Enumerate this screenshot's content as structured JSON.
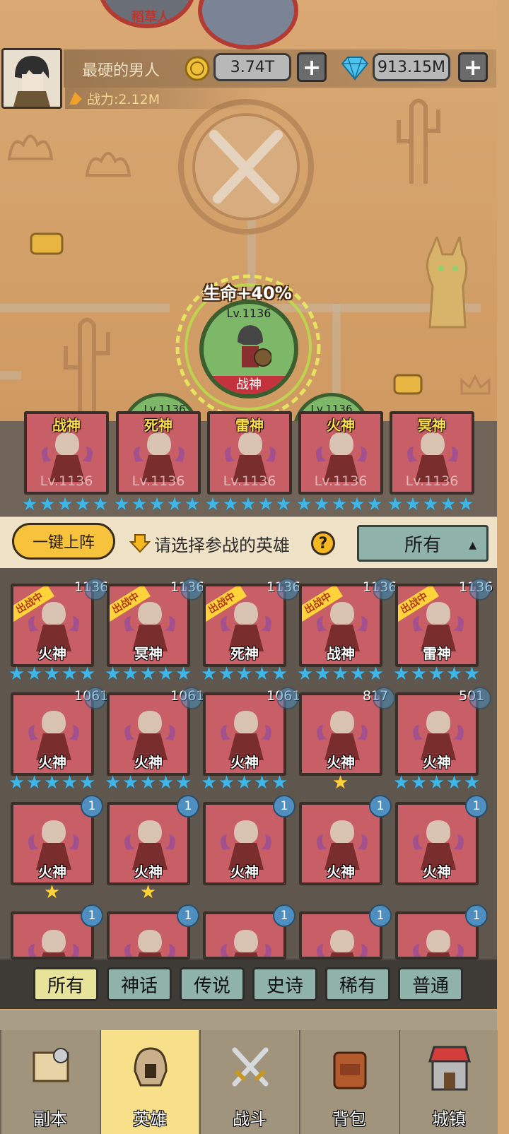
{
  "map": {
    "boss_left_label": "稻草人",
    "buff_text": "生命+40%",
    "center_hero_level": "Lv.1136",
    "center_hero_name": "战神",
    "side_levels": [
      "Lv.1136",
      "Lv.1136"
    ]
  },
  "header": {
    "player_name": "最硬的男人",
    "gold": "3.74T",
    "diamonds": "913.15M",
    "plus": "+",
    "power": "战力:2.12M"
  },
  "team": [
    {
      "name": "战神",
      "level": "Lv.1136",
      "stars": 5
    },
    {
      "name": "死神",
      "level": "Lv.1136",
      "stars": 5
    },
    {
      "name": "雷神",
      "level": "Lv.1136",
      "stars": 5
    },
    {
      "name": "火神",
      "level": "Lv.1136",
      "stars": 5
    },
    {
      "name": "冥神",
      "level": "Lv.1136",
      "stars": 5
    }
  ],
  "controls": {
    "auto_button": "一键上阵",
    "hint": "请选择参战的英雄",
    "help": "?",
    "filter": "所有"
  },
  "heroes": [
    {
      "name": "火神",
      "level": "1136",
      "deployed": "出战中",
      "stars": 5,
      "star_color": "blue"
    },
    {
      "name": "冥神",
      "level": "1136",
      "deployed": "出战中",
      "stars": 5,
      "star_color": "blue"
    },
    {
      "name": "死神",
      "level": "1136",
      "deployed": "出战中",
      "stars": 5,
      "star_color": "blue"
    },
    {
      "name": "战神",
      "level": "1136",
      "deployed": "出战中",
      "stars": 5,
      "star_color": "blue"
    },
    {
      "name": "雷神",
      "level": "1136",
      "deployed": "出战中",
      "stars": 5,
      "star_color": "blue"
    },
    {
      "name": "火神",
      "level": "1061",
      "stars": 5,
      "star_color": "blue"
    },
    {
      "name": "火神",
      "level": "1061",
      "stars": 5,
      "star_color": "blue"
    },
    {
      "name": "火神",
      "level": "1061",
      "stars": 5,
      "star_color": "blue"
    },
    {
      "name": "火神",
      "level": "817",
      "stars": 1,
      "star_color": "gold"
    },
    {
      "name": "火神",
      "level": "501",
      "stars": 5,
      "star_color": "blue"
    },
    {
      "name": "火神",
      "level": "1",
      "stars": 1,
      "star_color": "gold"
    },
    {
      "name": "火神",
      "level": "1",
      "stars": 1,
      "star_color": "gold"
    },
    {
      "name": "火神",
      "level": "1",
      "stars": 0
    },
    {
      "name": "火神",
      "level": "1",
      "stars": 0
    },
    {
      "name": "火神",
      "level": "1",
      "stars": 0
    },
    {
      "name": "",
      "level": "1",
      "stars": 0
    },
    {
      "name": "",
      "level": "1",
      "stars": 0
    },
    {
      "name": "",
      "level": "1",
      "stars": 0
    },
    {
      "name": "",
      "level": "1",
      "stars": 0
    },
    {
      "name": "",
      "level": "1",
      "stars": 0
    }
  ],
  "rarity_tabs": [
    "所有",
    "神话",
    "传说",
    "史诗",
    "稀有",
    "普通"
  ],
  "nav": [
    {
      "label": "副本",
      "icon": "map-scroll-icon"
    },
    {
      "label": "英雄",
      "icon": "hero-helmet-icon",
      "active": true
    },
    {
      "label": "战斗",
      "icon": "crossed-swords-icon"
    },
    {
      "label": "背包",
      "icon": "backpack-icon"
    },
    {
      "label": "城镇",
      "icon": "shop-building-icon"
    }
  ]
}
